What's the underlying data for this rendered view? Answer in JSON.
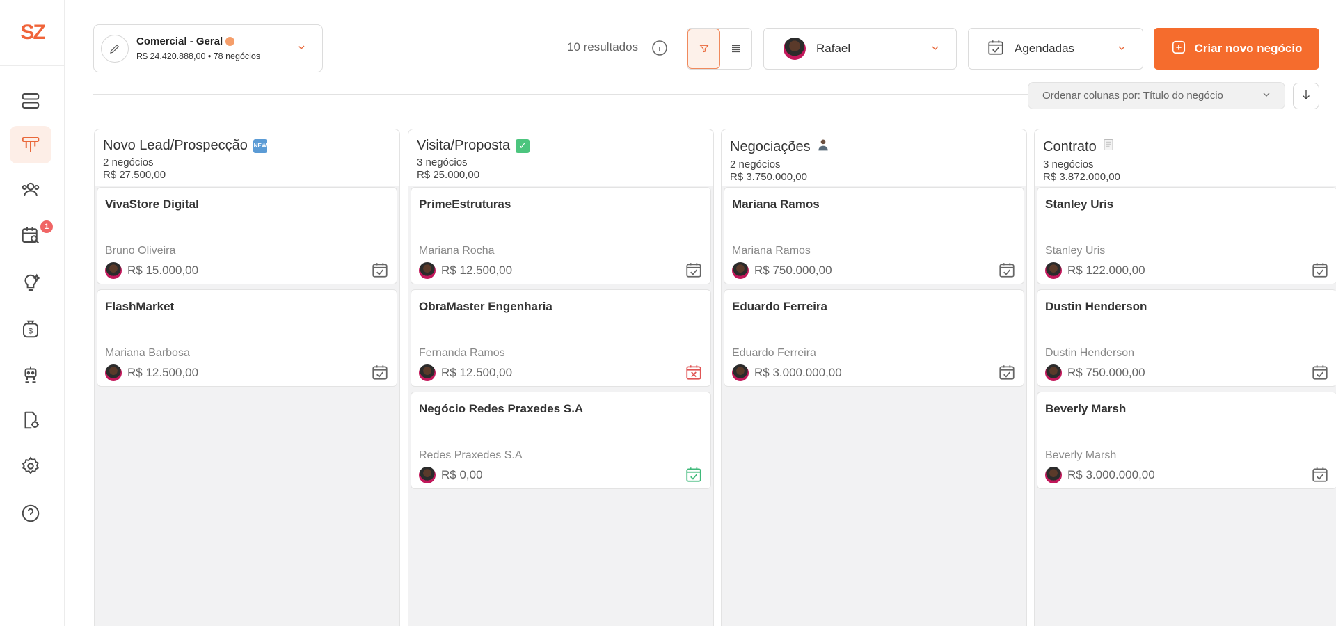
{
  "logo": "SZ",
  "sidebar": {
    "notification_count": "1",
    "items": [
      {
        "name": "storage-icon"
      },
      {
        "name": "kanban-icon"
      },
      {
        "name": "contacts-icon"
      },
      {
        "name": "calendar-search-icon"
      },
      {
        "name": "ideas-icon"
      },
      {
        "name": "finance-icon"
      },
      {
        "name": "robot-icon"
      },
      {
        "name": "documents-icon"
      },
      {
        "name": "settings-icon"
      },
      {
        "name": "help-icon"
      }
    ]
  },
  "funnel": {
    "name": "Comercial - Geral",
    "summary": "R$ 24.420.888,00 • 78 negócios"
  },
  "toolbar": {
    "results": "10 resultados",
    "user": "Rafael",
    "schedule_filter": "Agendadas",
    "create_label": "Criar novo negócio",
    "sort_label": "Ordenar colunas por: Título do negócio"
  },
  "colors": {
    "accent": "#f56c2d",
    "sched_late": "#e05555",
    "sched_done": "#3fb97a"
  },
  "columns": [
    {
      "title": "Novo Lead/Prospecção",
      "emoji": "NEW",
      "count": "2 negócios",
      "value": "R$ 27.500,00",
      "cards": [
        {
          "title": "VivaStore Digital",
          "contact": "Bruno Oliveira",
          "value": "R$ 15.000,00",
          "status": "ok"
        },
        {
          "title": "FlashMarket",
          "contact": "Mariana Barbosa",
          "value": "R$ 12.500,00",
          "status": "ok"
        }
      ]
    },
    {
      "title": "Visita/Proposta",
      "emoji": "✓",
      "count": "3 negócios",
      "value": "R$ 25.000,00",
      "cards": [
        {
          "title": "PrimeEstruturas",
          "contact": "Mariana Rocha",
          "value": "R$ 12.500,00",
          "status": "ok"
        },
        {
          "title": "ObraMaster Engenharia",
          "contact": "Fernanda Ramos",
          "value": "R$ 12.500,00",
          "status": "late"
        },
        {
          "title": "Negócio Redes Praxedes S.A",
          "contact": "Redes Praxedes S.A",
          "value": "R$ 0,00",
          "status": "done"
        }
      ]
    },
    {
      "title": "Negociações",
      "emoji": "person",
      "count": "2 negócios",
      "value": "R$ 3.750.000,00",
      "cards": [
        {
          "title": "Mariana Ramos",
          "contact": "Mariana Ramos",
          "value": "R$ 750.000,00",
          "status": "ok"
        },
        {
          "title": "Eduardo Ferreira",
          "contact": "Eduardo Ferreira",
          "value": "R$ 3.000.000,00",
          "status": "ok"
        }
      ]
    },
    {
      "title": "Contrato",
      "emoji": "doc",
      "count": "3 negócios",
      "value": "R$ 3.872.000,00",
      "cards": [
        {
          "title": "Stanley Uris",
          "contact": "Stanley Uris",
          "value": "R$ 122.000,00",
          "status": "ok"
        },
        {
          "title": "Dustin Henderson",
          "contact": "Dustin Henderson",
          "value": "R$ 750.000,00",
          "status": "ok"
        },
        {
          "title": "Beverly Marsh",
          "contact": "Beverly Marsh",
          "value": "R$ 3.000.000,00",
          "status": "ok"
        }
      ]
    }
  ]
}
